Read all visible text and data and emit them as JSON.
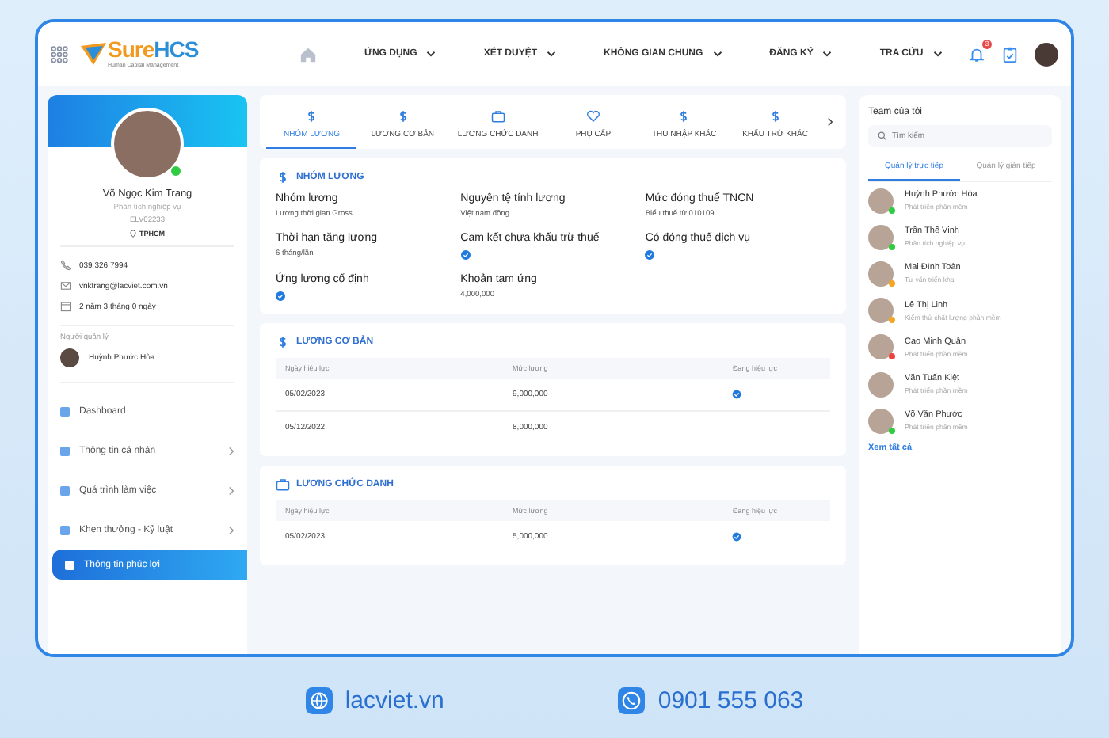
{
  "logo": {
    "brand_a": "Sure",
    "brand_b": "HCS",
    "tagline": "Human Capital Management"
  },
  "nav": [
    {
      "label": "ỨNG DỤNG"
    },
    {
      "label": "XÉT DUYỆT"
    },
    {
      "label": "KHÔNG GIAN CHUNG"
    },
    {
      "label": "ĐĂNG KÝ"
    },
    {
      "label": "TRA CỨU"
    }
  ],
  "notification_count": "3",
  "profile": {
    "name": "Võ Ngọc Kim Trang",
    "role": "Phân tích nghiệp vụ",
    "code": "ELV02233",
    "location": "TPHCM",
    "online": true,
    "contacts": [
      {
        "kind": "phone",
        "text": "039 326 7994"
      },
      {
        "kind": "mail",
        "text": "vnktrang@lacviet.com.vn"
      },
      {
        "kind": "calendar",
        "text": "2 năm 3 tháng 0 ngày"
      }
    ],
    "manager_label": "Người quản lý",
    "manager": "Huỳnh Phước Hòa"
  },
  "sidebar": {
    "items": [
      {
        "label": "Dashboard",
        "expandable": false,
        "selected": false
      },
      {
        "label": "Thông tin cá nhân",
        "expandable": true,
        "selected": false
      },
      {
        "label": "Quá trình làm việc",
        "expandable": true,
        "selected": false
      },
      {
        "label": "Khen thưởng - Kỷ luật",
        "expandable": true,
        "selected": false
      },
      {
        "label": "Thông tin phúc lợi",
        "expandable": false,
        "selected": true
      }
    ]
  },
  "tabs": [
    {
      "label": "NHÓM LƯƠNG",
      "kind": "dollar",
      "selected": true
    },
    {
      "label": "LƯƠNG CƠ BẢN",
      "kind": "dollar",
      "selected": false
    },
    {
      "label": "LƯƠNG CHỨC DANH",
      "kind": "bag",
      "selected": false
    },
    {
      "label": "PHỤ CẤP",
      "kind": "heart",
      "selected": false
    },
    {
      "label": "THU NHẬP KHÁC",
      "kind": "dollar",
      "selected": false
    },
    {
      "label": "KHẤU TRỪ KHÁC",
      "kind": "dollar",
      "selected": false
    }
  ],
  "salary_group": {
    "title": "NHÓM LƯƠNG",
    "fields": [
      {
        "label": "Nhóm lương",
        "kind": "text",
        "value": "Lương thời gian Gross"
      },
      {
        "label": "Nguyên tệ tính lương",
        "kind": "text",
        "value": "Việt nam đồng"
      },
      {
        "label": "Mức đóng thuế TNCN",
        "kind": "text",
        "value": "Biểu thuế từ 010109"
      },
      {
        "label": "Thời hạn tăng lương",
        "kind": "text",
        "value": "6 tháng/lần"
      },
      {
        "label": "Cam kết chưa khấu trừ thuế",
        "kind": "check",
        "checked": true
      },
      {
        "label": "Có đóng thuế dịch vụ",
        "kind": "check",
        "checked": true
      },
      {
        "label": "Ứng lương cố định",
        "kind": "check",
        "checked": true
      },
      {
        "label": "Khoản tạm ứng",
        "kind": "text",
        "value": "4,000,000"
      }
    ]
  },
  "tables": [
    {
      "title": "LƯƠNG CƠ BẢN",
      "kind": "dollar",
      "columns": [
        "Ngày hiệu lực",
        "Mức lương",
        "Đang hiệu lực"
      ],
      "rows": [
        {
          "date": "05/02/2023",
          "amount": "9,000,000",
          "active": true
        },
        {
          "date": "05/12/2022",
          "amount": "8,000,000",
          "active": false
        }
      ]
    },
    {
      "title": "LƯƠNG CHỨC DANH",
      "kind": "bag",
      "columns": [
        "Ngày hiệu lực",
        "Mức lương",
        "Đang hiệu lực"
      ],
      "rows": [
        {
          "date": "05/02/2023",
          "amount": "5,000,000",
          "active": true
        }
      ]
    }
  ],
  "team": {
    "title": "Team của tôi",
    "search": {
      "placeholder": "Tìm kiếm"
    },
    "tabs": [
      {
        "label": "Quản lý trực tiếp",
        "selected": true
      },
      {
        "label": "Quản lý gián tiếp",
        "selected": false
      }
    ],
    "members": [
      {
        "name": "Huỳnh Phước Hòa",
        "role": "Phát triển phần mềm",
        "color": "#2ecc40"
      },
      {
        "name": "Trần Thế Vinh",
        "role": "Phân tích nghiệp vụ",
        "color": "#2ecc40"
      },
      {
        "name": "Mai Đình Toàn",
        "role": "Tư vấn triển khai",
        "color": "#f5a623"
      },
      {
        "name": "Lê Thị Linh",
        "role": "Kiểm thử chất lượng phần mềm",
        "color": "#f5a623"
      },
      {
        "name": "Cao Minh Quân",
        "role": "Phát triển phần mềm",
        "color": "#f0413c"
      },
      {
        "name": "Văn Tuấn Kiệt",
        "role": "Phát triển phần mềm"
      },
      {
        "name": "Võ Văn Phước",
        "role": "Phát triển phần mềm",
        "color": "#2ecc40"
      }
    ],
    "see_all": "Xem tất cả"
  },
  "footer": {
    "website": "lacviet.vn",
    "phone": "0901 555 063"
  }
}
